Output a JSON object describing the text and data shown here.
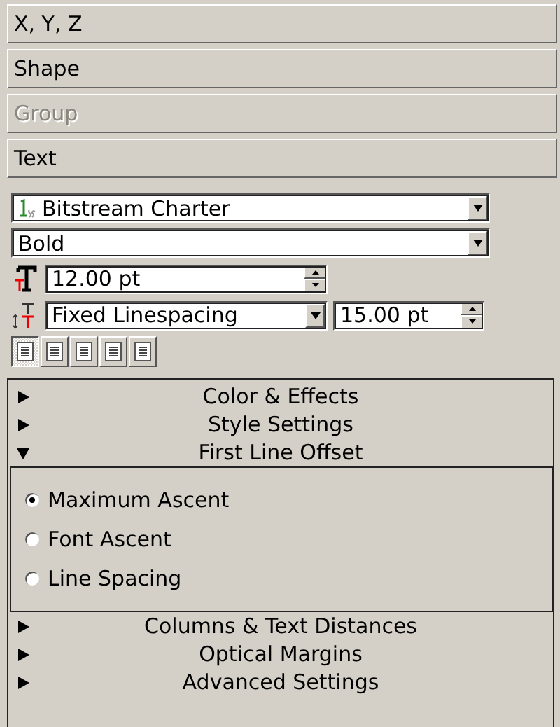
{
  "sections": [
    {
      "label": "X, Y, Z",
      "disabled": false
    },
    {
      "label": "Shape",
      "disabled": false
    },
    {
      "label": "Group",
      "disabled": true
    },
    {
      "label": "Text",
      "disabled": false
    }
  ],
  "font_family": {
    "value": "Bitstream Charter"
  },
  "font_style": {
    "value": "Bold"
  },
  "font_size": {
    "value": "12.00 pt"
  },
  "line_spacing": {
    "mode": "Fixed Linespacing",
    "value": "15.00 pt"
  },
  "alignment": [
    {
      "selected": true
    },
    {
      "selected": false
    },
    {
      "selected": false
    },
    {
      "selected": false
    },
    {
      "selected": false
    }
  ],
  "groups": [
    {
      "label": "Color & Effects",
      "expanded": false
    },
    {
      "label": "Style Settings",
      "expanded": false
    },
    {
      "label": "First Line Offset",
      "expanded": true,
      "options": [
        {
          "label": "Maximum Ascent",
          "selected": true
        },
        {
          "label": "Font Ascent",
          "selected": false
        },
        {
          "label": "Line Spacing",
          "selected": false
        }
      ]
    },
    {
      "label": "Columns & Text Distances",
      "expanded": false
    },
    {
      "label": "Optical Margins",
      "expanded": false
    },
    {
      "label": "Advanced Settings",
      "expanded": false
    }
  ]
}
